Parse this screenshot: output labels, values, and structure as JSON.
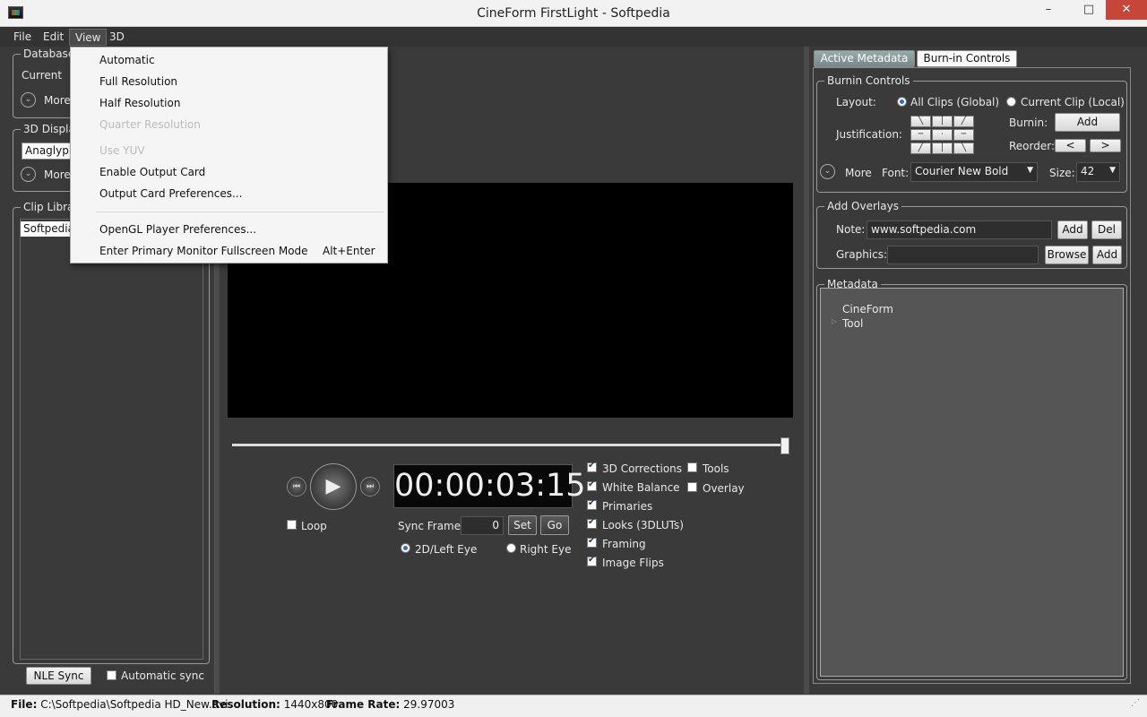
{
  "window": {
    "title": "CineForm FirstLight - Softpedia",
    "minimize": "–",
    "maximize": "□",
    "close": "✕"
  },
  "menubar": {
    "file": "File",
    "edit": "Edit",
    "view": "View",
    "three_d": "3D"
  },
  "view_menu": {
    "automatic": "Automatic",
    "full_resolution": "Full Resolution",
    "half_resolution": "Half Resolution",
    "quarter_resolution": "Quarter Resolution",
    "use_yuv": "Use YUV",
    "enable_output_card": "Enable Output Card",
    "output_card_prefs": "Output Card Preferences...",
    "opengl_prefs": "OpenGL Player Preferences...",
    "fullscreen": "Enter Primary Monitor Fullscreen Mode",
    "fullscreen_shortcut": "Alt+Enter"
  },
  "left": {
    "database_title": "Database",
    "database_current": "Current",
    "more": "More",
    "display_title": "3D Display",
    "display_value": "Anaglyph",
    "clip_title": "Clip Library",
    "clip_item": "Softpedia",
    "nle_sync": "NLE Sync",
    "auto_sync": "Automatic sync"
  },
  "player": {
    "timecode": "00:00:03:15",
    "loop": "Loop",
    "sync_frame_label": "Sync Frame:",
    "sync_frame_value": "0",
    "set": "Set",
    "go": "Go",
    "left_eye": "2D/Left Eye",
    "right_eye": "Right Eye",
    "progress": 1.0
  },
  "toggles": {
    "corrections": "3D Corrections",
    "white_balance": "White  Balance",
    "primaries": "Primaries",
    "looks": "Looks (3DLUTs)",
    "framing": "Framing",
    "image_flips": "Image Flips",
    "tools": "Tools",
    "overlay": "Overlay"
  },
  "right": {
    "tab_active": "Active Metadata",
    "tab_burnin": "Burn-in Controls",
    "burnin_title": "Burnin Controls",
    "layout_label": "Layout:",
    "all_clips": "All Clips (Global)",
    "current_clip": "Current Clip (Local)",
    "justification_label": "Justification:",
    "burnin_label": "Burnin:",
    "add": "Add",
    "reorder_label": "Reorder:",
    "reorder_left": "<",
    "reorder_right": ">",
    "more": "More",
    "font_label": "Font:",
    "font_value": "Courier New Bold",
    "size_label": "Size:",
    "size_value": "42",
    "overlays_title": "Add Overlays",
    "note_label": "Note:",
    "note_value": "www.softpedia.com",
    "del": "Del",
    "graphics_label": "Graphics:",
    "browse": "Browse",
    "metadata_title": "Metadata",
    "tree_root": "CineForm",
    "tree_child": "Tool"
  },
  "status": {
    "file_label": "File:",
    "file_value": "C:\\Softpedia\\Softpedia HD_New.avi",
    "res_label": "Resolution:",
    "res_value": "1440x800",
    "fps_label": "Frame Rate:",
    "fps_value": "29.97003"
  }
}
